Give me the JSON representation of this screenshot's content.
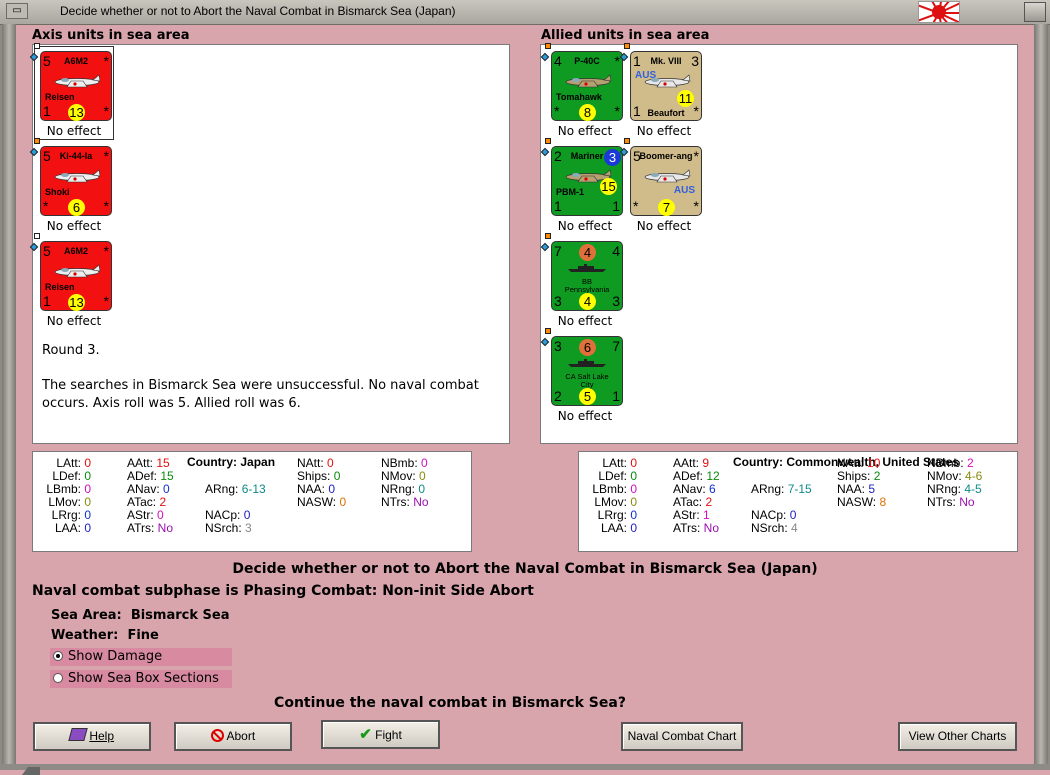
{
  "window": {
    "title": "Decide whether or not to Abort the Naval Combat in Bismarck Sea (Japan)"
  },
  "axis": {
    "heading": "Axis units in sea area",
    "units": [
      {
        "name": "A6M2",
        "subname": "Reisen",
        "tl": "5",
        "bl": "1",
        "br": "*",
        "tr": "*",
        "circle": "13",
        "effect": "No effect",
        "color": "red",
        "icon": "fighter-plane-icon",
        "indicator": "#ffffff"
      },
      {
        "name": "Ki-44-Ia",
        "subname": "Shoki",
        "tl": "5",
        "bl": "*",
        "br": "*",
        "tr": "*",
        "circle": "6",
        "effect": "No effect",
        "color": "red",
        "icon": "fighter-plane-icon",
        "indicator": "#ff8c00"
      },
      {
        "name": "A6M2",
        "subname": "Reisen",
        "tl": "5",
        "bl": "1",
        "br": "*",
        "tr": "*",
        "circle": "13",
        "effect": "No effect",
        "color": "red",
        "icon": "fighter-plane-icon",
        "indicator": "#ffffff"
      }
    ],
    "messages": {
      "round": "Round 3.",
      "search": "The searches in Bismarck Sea were unsuccessful.  No naval combat occurs.  Axis roll was 5.  Allied roll was 6."
    }
  },
  "allied": {
    "heading": "Allied units in sea area",
    "units": [
      {
        "name": "P-40C",
        "subname": "Tomahawk",
        "tl": "4",
        "tr": "*",
        "bl": "*",
        "br": "*",
        "circle": "8",
        "effect": "No effect",
        "color": "green",
        "icon": "fighter-plane-icon"
      },
      {
        "name": "Mk. VIII",
        "subname": "Beaufort",
        "tag": "AUS",
        "tl": "1",
        "tr": "3",
        "bl": "1",
        "br": "*",
        "circle": "11",
        "effect": "No effect",
        "color": "tan",
        "icon": "bomber-plane-icon"
      },
      {
        "name": "Mariner",
        "subname": "PBM-1",
        "tl": "2",
        "tr": "3",
        "bl": "1",
        "br": "1",
        "circle": "15",
        "effect": "No effect",
        "color": "green",
        "icon": "flying-boat-icon"
      },
      {
        "name": "Boomer-ang",
        "subname": "",
        "tag": "AUS",
        "tl": "5",
        "tr": "*",
        "bl": "*",
        "br": "*",
        "circle": "7",
        "effect": "No effect",
        "color": "tan",
        "icon": "fighter-plane-icon"
      },
      {
        "name": "BB",
        "subname": "Pennsylvania",
        "tl": "7",
        "tr": "4",
        "bl": "3",
        "br": "3",
        "circle_top": "4",
        "circle": "4",
        "effect": "No effect",
        "color": "green",
        "icon": "battleship-icon"
      },
      {
        "name": "CA Salt Lake",
        "subname": "City",
        "tl": "3",
        "tr": "7",
        "bl": "2",
        "br": "1",
        "circle_top": "6",
        "circle": "5",
        "effect": "No effect",
        "color": "green",
        "icon": "cruiser-icon"
      }
    ]
  },
  "axis_stats": {
    "country_label": "Country:",
    "country": "Japan",
    "rows": [
      [
        [
          "LAtt:",
          "0",
          "red"
        ],
        [
          "AAtt:",
          "15",
          "red"
        ],
        [
          "NAtt:",
          "0",
          "red"
        ],
        [
          "NBmb:",
          "0",
          "magenta"
        ]
      ],
      [
        [
          "LDef:",
          "0",
          "green"
        ],
        [
          "ADef:",
          "15",
          "green"
        ],
        [
          "Ships:",
          "0",
          "green"
        ],
        [
          "NMov:",
          "0",
          "olive"
        ]
      ],
      [
        [
          "LBmb:",
          "0",
          "magenta"
        ],
        [
          "ANav:",
          "0",
          "blue"
        ],
        [
          "ARng:",
          "6-13",
          "teal"
        ],
        [
          "NAA:",
          "0",
          "navy"
        ],
        [
          "NRng:",
          "0",
          "teal"
        ]
      ],
      [
        [
          "LMov:",
          "0",
          "olive"
        ],
        [
          "ATac:",
          "2",
          "red"
        ],
        [
          "NASW:",
          "0",
          "orange"
        ],
        [
          "NTrs:",
          "No",
          "purple"
        ]
      ],
      [
        [
          "LRrg:",
          "0",
          "blue"
        ],
        [
          "AStr:",
          "0",
          "magenta"
        ],
        [
          "NACp:",
          "0",
          "navy"
        ]
      ],
      [
        [
          "LAA:",
          "0",
          "navy"
        ],
        [
          "ATrs:",
          "No",
          "purple"
        ],
        [
          "NSrch:",
          "3",
          "gray"
        ]
      ]
    ]
  },
  "allied_stats": {
    "country_label": "Country:",
    "country": "Commonwealth, United States",
    "rows": [
      [
        [
          "LAtt:",
          "0",
          "red"
        ],
        [
          "AAtt:",
          "9",
          "red"
        ],
        [
          "NAtt:",
          "10",
          "red"
        ],
        [
          "NBmb:",
          "2",
          "magenta"
        ]
      ],
      [
        [
          "LDef:",
          "0",
          "green"
        ],
        [
          "ADef:",
          "12",
          "green"
        ],
        [
          "Ships:",
          "2",
          "green"
        ],
        [
          "NMov:",
          "4-6",
          "olive"
        ]
      ],
      [
        [
          "LBmb:",
          "0",
          "magenta"
        ],
        [
          "ANav:",
          "6",
          "blue"
        ],
        [
          "ARng:",
          "7-15",
          "teal"
        ],
        [
          "NAA:",
          "5",
          "navy"
        ],
        [
          "NRng:",
          "4-5",
          "teal"
        ]
      ],
      [
        [
          "LMov:",
          "0",
          "olive"
        ],
        [
          "ATac:",
          "2",
          "red"
        ],
        [
          "NASW:",
          "8",
          "orange"
        ],
        [
          "NTrs:",
          "No",
          "purple"
        ]
      ],
      [
        [
          "LRrg:",
          "0",
          "blue"
        ],
        [
          "AStr:",
          "1",
          "magenta"
        ],
        [
          "NACp:",
          "0",
          "navy"
        ]
      ],
      [
        [
          "LAA:",
          "0",
          "navy"
        ],
        [
          "ATrs:",
          "No",
          "purple"
        ],
        [
          "NSrch:",
          "4",
          "gray"
        ]
      ]
    ]
  },
  "main": {
    "decision_title": "Decide whether or not to Abort the Naval Combat in Bismarck Sea (Japan)",
    "subphase": "Naval combat subphase is Phasing Combat: Non-init Side Abort",
    "sea_area_label": "Sea Area:",
    "sea_area": "Bismarck Sea",
    "weather_label": "Weather:",
    "weather": "Fine",
    "show_damage": "Show Damage",
    "show_sea_box": "Show Sea Box Sections",
    "show_damage_selected": true,
    "question": "Continue the naval combat in Bismarck Sea?"
  },
  "buttons": {
    "help": "Help",
    "abort": "Abort",
    "fight": "Fight",
    "naval_chart": "Naval Combat Chart",
    "other_charts": "View Other Charts"
  }
}
